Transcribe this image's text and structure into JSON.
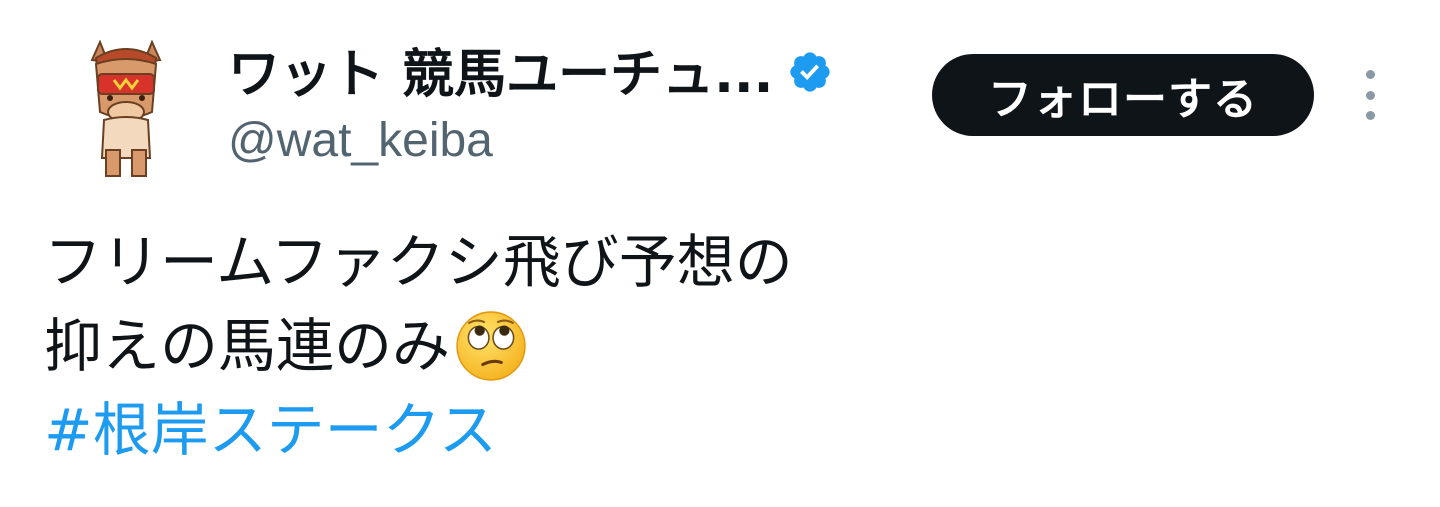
{
  "author": {
    "display_name": "ワット 競馬ユーチュ...",
    "handle": "@wat_keiba",
    "verified": true,
    "avatar_icon": "horse-mascot-avatar",
    "verified_icon": "verified-badge-icon"
  },
  "actions": {
    "follow_label": "フォローする",
    "more_icon": "more-vertical-icon"
  },
  "tweet": {
    "line1": "フリームファクシ飛び予想の",
    "line2": "抑えの馬連のみ",
    "line2_emoji": "face-with-rolling-eyes-emoji",
    "hashtag": "#根岸ステークス"
  },
  "colors": {
    "text_primary": "#0f1419",
    "text_secondary": "#536471",
    "link": "#1d9bf0",
    "follow_bg": "#0f1419",
    "verified": "#1d9bf0"
  }
}
